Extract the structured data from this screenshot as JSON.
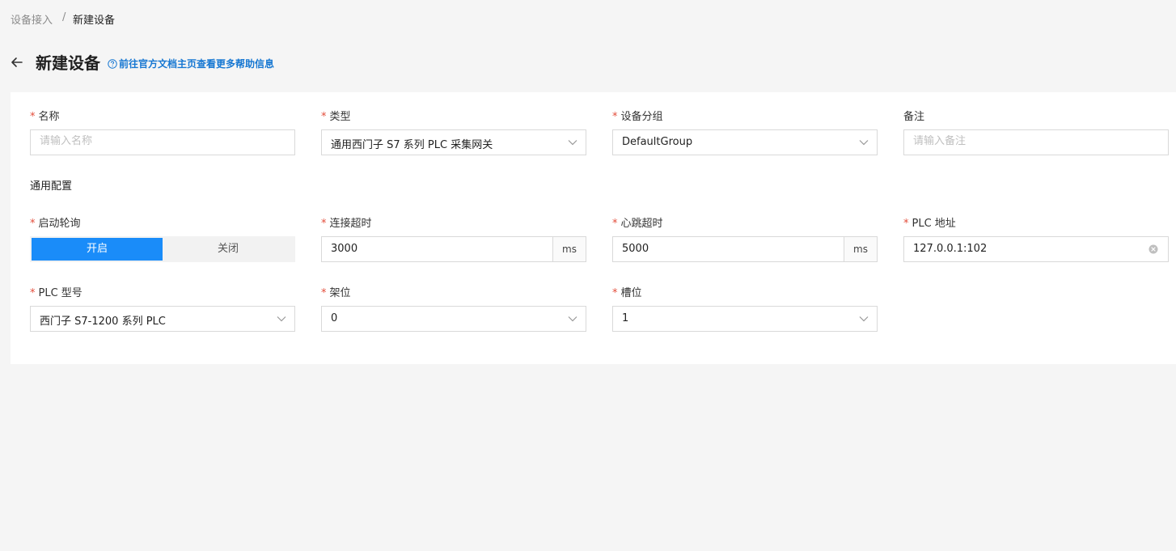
{
  "breadcrumb": {
    "parent": "设备接入",
    "separator": "/",
    "current": "新建设备"
  },
  "header": {
    "title": "新建设备",
    "help_link": "前往官方文档主页查看更多帮助信息"
  },
  "form": {
    "name": {
      "label": "名称",
      "required": true,
      "placeholder": "请输入名称",
      "value": ""
    },
    "type": {
      "label": "类型",
      "required": true,
      "value": "通用西门子 S7 系列 PLC 采集网关"
    },
    "group": {
      "label": "设备分组",
      "required": true,
      "value": "DefaultGroup"
    },
    "remark": {
      "label": "备注",
      "required": false,
      "placeholder": "请输入备注",
      "value": ""
    },
    "section_title": "通用配置",
    "polling": {
      "label": "启动轮询",
      "required": true,
      "on_label": "开启",
      "off_label": "关闭",
      "selected": "开启"
    },
    "connect_timeout": {
      "label": "连接超时",
      "required": true,
      "value": "3000",
      "unit": "ms"
    },
    "heartbeat_timeout": {
      "label": "心跳超时",
      "required": true,
      "value": "5000",
      "unit": "ms"
    },
    "plc_address": {
      "label": "PLC 地址",
      "required": true,
      "value": "127.0.0.1:102"
    },
    "plc_model": {
      "label": "PLC 型号",
      "required": true,
      "value": "西门子 S7-1200 系列 PLC"
    },
    "rack": {
      "label": "架位",
      "required": true,
      "value": "0"
    },
    "slot": {
      "label": "槽位",
      "required": true,
      "value": "1"
    }
  },
  "colors": {
    "primary": "#1a8cf9",
    "link": "#1677d2",
    "required_mark": "#e34d3b",
    "page_bg": "#f5f5f5",
    "card_bg": "#ffffff",
    "border": "#d9d9d9"
  },
  "icons": {
    "back": "arrow-left-icon",
    "help": "question-circle-icon",
    "select": "chevron-down-icon",
    "clear": "clear-circle-icon"
  }
}
